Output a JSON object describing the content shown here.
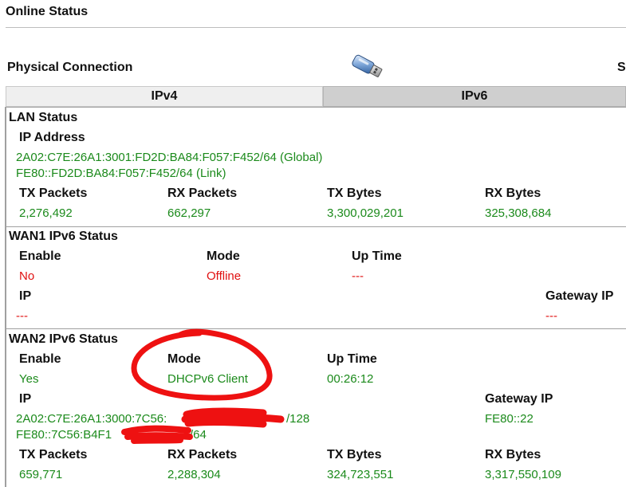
{
  "page": {
    "title": "Online Status",
    "physical_connection_label": "Physical Connection",
    "cut_off_text": "S"
  },
  "tabs": {
    "ipv4": "IPv4",
    "ipv6": "IPv6",
    "active": "IPv6"
  },
  "lan": {
    "title": "LAN Status",
    "ip_label": "IP Address",
    "ip_global": "2A02:C7E:26A1:3001:FD2D:BA84:F057:F452/64 (Global)",
    "ip_link": "FE80::FD2D:BA84:F057:F452/64 (Link)",
    "headers": [
      "TX Packets",
      "RX Packets",
      "TX Bytes",
      "RX Bytes"
    ],
    "values": [
      "2,276,492",
      "662,297",
      "3,300,029,201",
      "325,308,684"
    ]
  },
  "wan1": {
    "title": "WAN1 IPv6 Status",
    "enable_label": "Enable",
    "enable_value": "No",
    "mode_label": "Mode",
    "mode_value": "Offline",
    "uptime_label": "Up Time",
    "uptime_value": "---",
    "ip_label": "IP",
    "ip_value": "---",
    "gateway_label": "Gateway IP",
    "gateway_value": "---"
  },
  "wan2": {
    "title": "WAN2 IPv6 Status",
    "enable_label": "Enable",
    "enable_value": "Yes",
    "mode_label": "Mode",
    "mode_value": "DHCPv6 Client",
    "uptime_label": "Up Time",
    "uptime_value": "00:26:12",
    "ip_label": "IP",
    "ip_value_1_prefix": "2A02:C7E:26A1:3000:7C56:",
    "ip_value_1_suffix": "/128",
    "ip_value_2_prefix": "FE80::7C56:B4F1",
    "ip_value_2_suffix": "/64",
    "gateway_label": "Gateway IP",
    "gateway_value": "FE80::22",
    "headers": [
      "TX Packets",
      "RX Packets",
      "TX Bytes",
      "RX Bytes"
    ],
    "values": [
      "659,771",
      "2,288,304",
      "324,723,551",
      "3,317,550,109"
    ]
  },
  "colors": {
    "value_green": "#1b8a1b",
    "value_red": "#e01010",
    "annotation_red": "#ee1111"
  },
  "icons": {
    "connection": "usb-plug-icon"
  }
}
